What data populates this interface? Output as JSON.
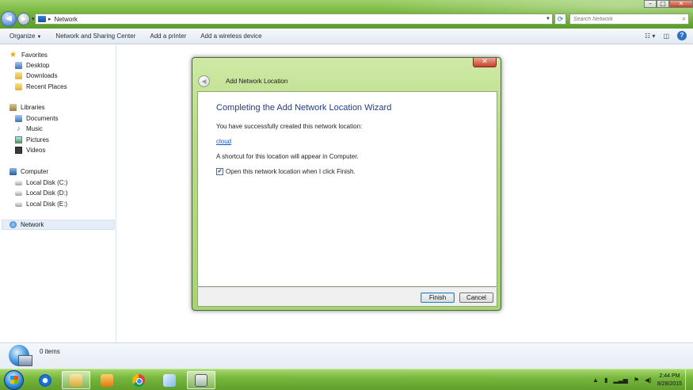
{
  "window": {
    "address_text": "Network",
    "search_placeholder": "Search Network",
    "controls": {
      "minimize": "–",
      "maximize": "□",
      "close": "✕"
    }
  },
  "nav_buttons": {
    "back": "◀",
    "forward": "▶",
    "recent": "▾"
  },
  "toolbar": {
    "organize": "Organize",
    "items": [
      "Network and Sharing Center",
      "Add a printer",
      "Add a wireless device"
    ],
    "help": "?"
  },
  "navpane": {
    "favorites": {
      "label": "Favorites",
      "items": [
        "Desktop",
        "Downloads",
        "Recent Places"
      ]
    },
    "libraries": {
      "label": "Libraries",
      "items": [
        "Documents",
        "Music",
        "Pictures",
        "Videos"
      ]
    },
    "computer": {
      "label": "Computer",
      "items": [
        "Local Disk (C:)",
        "Local Disk (D:)",
        "Local Disk (E:)"
      ]
    },
    "network": {
      "label": "Network"
    }
  },
  "details": {
    "item_count": "0 items"
  },
  "dialog": {
    "title": "Add Network Location",
    "heading": "Completing the Add Network Location Wizard",
    "success_text": "You have successfully created this network location:",
    "location_name": "cloud",
    "shortcut_text": "A shortcut for this location will appear in Computer.",
    "open_checkbox_label": "Open this network location when I click Finish.",
    "open_checkbox_checked": true,
    "finish_label": "Finish",
    "cancel_label": "Cancel",
    "close_glyph": "✕",
    "back_glyph": "◀"
  },
  "taskbar": {
    "clock_time": "2:44 PM",
    "clock_date": "8/28/2015",
    "apps": [
      "internet-explorer-icon",
      "windows-explorer-icon",
      "media-player-icon",
      "chrome-icon",
      "file-icon",
      "network-wizard-icon"
    ]
  },
  "colors": {
    "aero_green": "#78b83e",
    "dialog_heading": "#1f3d8a",
    "link": "#0a5ac8"
  }
}
